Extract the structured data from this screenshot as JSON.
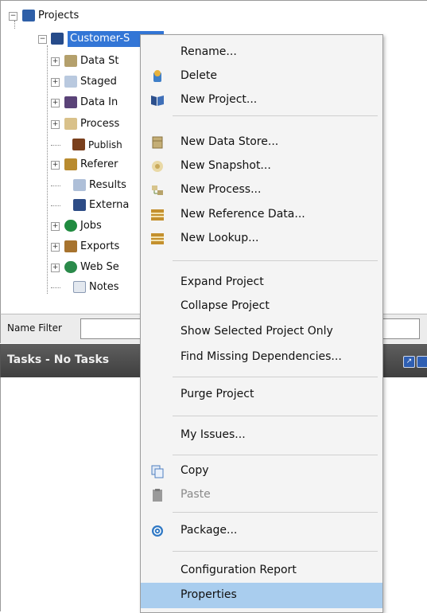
{
  "tree": {
    "root": "Projects",
    "project": "Customer-S",
    "children": [
      "Data St",
      "Staged",
      "Data In",
      "Process",
      "Publish",
      "Referer",
      "Results",
      "Externa",
      "Jobs",
      "Exports",
      "Web Se",
      "Notes"
    ]
  },
  "filter": {
    "label": "Name Filter",
    "value": ""
  },
  "tasks": {
    "title": "Tasks - No Tasks"
  },
  "menu": {
    "rename": "Rename...",
    "delete": "Delete",
    "new_project": "New Project...",
    "new_data_store": "New Data Store...",
    "new_snapshot": "New Snapshot...",
    "new_process": "New Process...",
    "new_reference_data": "New Reference Data...",
    "new_lookup": "New Lookup...",
    "expand_project": "Expand Project",
    "collapse_project": "Collapse Project",
    "show_selected_only": "Show Selected Project Only",
    "find_missing_deps": "Find Missing Dependencies...",
    "purge_project": "Purge Project",
    "my_issues": "My Issues...",
    "copy": "Copy",
    "paste": "Paste",
    "package": "Package...",
    "config_report": "Configuration Report",
    "properties": "Properties"
  },
  "colors": {
    "selection": "#a9cdee",
    "project_highlight": "#3376d6",
    "tasks_header": "#4a4a4a"
  }
}
